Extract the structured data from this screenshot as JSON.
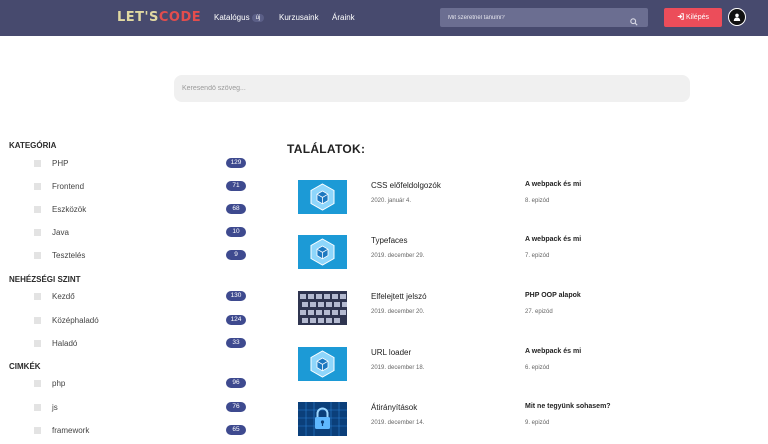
{
  "header": {
    "logo_main": "LET'S",
    "logo_accent": "CODE",
    "nav": [
      {
        "label": "Katalógus",
        "badge": "új"
      },
      {
        "label": "Kurzusaink"
      },
      {
        "label": "Áraink"
      }
    ],
    "search_placeholder": "Mit szeretnél tanulni?",
    "logout_label": "Kilépés"
  },
  "main_search": {
    "placeholder": "Keresendő szöveg..."
  },
  "sidebar": {
    "kategoria": {
      "title": "KATEGÓRIA",
      "items": [
        {
          "label": "PHP",
          "count": "129"
        },
        {
          "label": "Frontend",
          "count": "71"
        },
        {
          "label": "Eszközök",
          "count": "68"
        },
        {
          "label": "Java",
          "count": "10"
        },
        {
          "label": "Tesztelés",
          "count": "9"
        }
      ]
    },
    "szint": {
      "title": "NEHÉZSÉGI SZINT",
      "items": [
        {
          "label": "Kezdő",
          "count": "130"
        },
        {
          "label": "Középhaladó",
          "count": "124"
        },
        {
          "label": "Haladó",
          "count": "33"
        }
      ]
    },
    "cimkek": {
      "title": "CIMKÉK",
      "items": [
        {
          "label": "php",
          "count": "96"
        },
        {
          "label": "js",
          "count": "76"
        },
        {
          "label": "framework",
          "count": "65"
        }
      ]
    }
  },
  "results": {
    "title": "TALÁLATOK:",
    "items": [
      {
        "title": "CSS előfeldolgozók",
        "date": "2020. január 4.",
        "series": "A webpack és mi",
        "episode": "8. epizód",
        "thumb": "webpack"
      },
      {
        "title": "Typefaces",
        "date": "2019. december 29.",
        "series": "A webpack és mi",
        "episode": "7. epizód",
        "thumb": "webpack"
      },
      {
        "title": "Elfelejtett jelszó",
        "date": "2019. december 20.",
        "series": "PHP OOP alapok",
        "episode": "27. epizód",
        "thumb": "keyboard"
      },
      {
        "title": "URL loader",
        "date": "2019. december 18.",
        "series": "A webpack és mi",
        "episode": "6. epizód",
        "thumb": "webpack"
      },
      {
        "title": "Átirányítások",
        "date": "2019. december 14.",
        "series": "Mit ne tegyünk sohasem?",
        "episode": "9. epizód",
        "thumb": "lock"
      }
    ]
  },
  "colors": {
    "header_bg": "#474a6e",
    "accent": "#ec4d5a",
    "badge": "#3e4a8f",
    "thumb_blue": "#1c9ad6"
  }
}
